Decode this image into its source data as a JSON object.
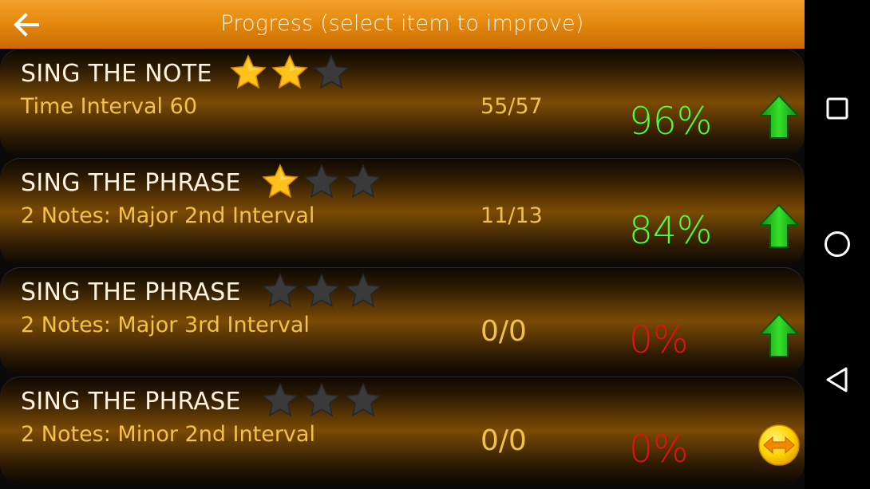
{
  "header": {
    "title": "Progress (select item to improve)",
    "back_icon": "arrow-left-icon"
  },
  "colors": {
    "header_top": "#f3a12a",
    "header_bottom": "#c96a05",
    "title_text": "#fdf3e0",
    "subtitle_text": "#f2c14a",
    "score_text": "#f0c04d",
    "percent_good": "#4cff3a",
    "percent_bad": "#e01212",
    "star_filled": "#ffc21a",
    "star_empty": "#3a3a3a"
  },
  "items": [
    {
      "title": "SING THE NOTE",
      "stars_filled": 2,
      "stars_total": 3,
      "subtitle": "Time Interval 60",
      "score": "55/57",
      "percent": "96%",
      "percent_status": "good",
      "trend_icon": "arrow-up-icon"
    },
    {
      "title": "SING THE PHRASE",
      "stars_filled": 1,
      "stars_total": 3,
      "subtitle": "2 Notes: Major 2nd Interval",
      "score": "11/13",
      "percent": "84%",
      "percent_status": "good",
      "trend_icon": "arrow-up-icon"
    },
    {
      "title": "SING THE PHRASE",
      "stars_filled": 0,
      "stars_total": 3,
      "subtitle": "2 Notes: Major 3rd Interval",
      "score": "0/0",
      "percent": "0%",
      "percent_status": "bad",
      "trend_icon": "arrow-up-icon"
    },
    {
      "title": "SING THE PHRASE",
      "stars_filled": 0,
      "stars_total": 3,
      "subtitle": "2 Notes: Minor 2nd Interval",
      "score": "0/0",
      "percent": "0%",
      "percent_status": "bad",
      "trend_icon": "arrow-left-right-icon"
    }
  ],
  "nav": {
    "recents_icon": "square-recents-icon",
    "home_icon": "circle-home-icon",
    "back_icon": "triangle-back-icon"
  }
}
